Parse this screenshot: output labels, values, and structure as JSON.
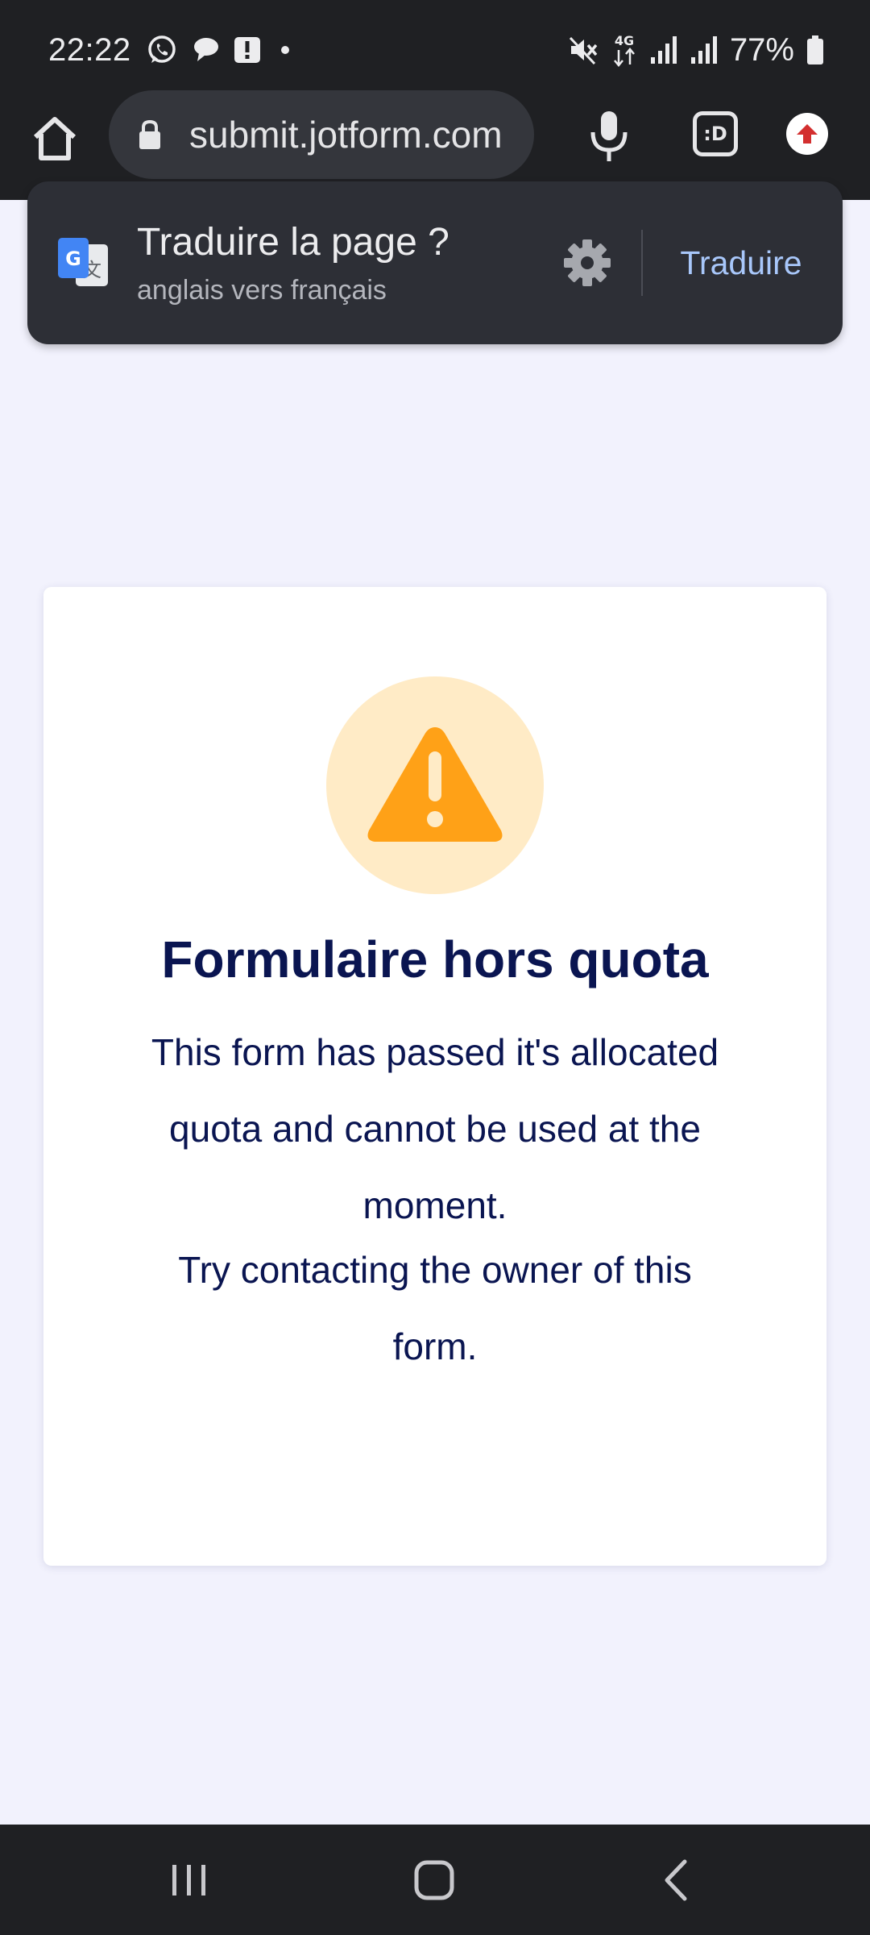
{
  "status_bar": {
    "time": "22:22",
    "battery": "77%",
    "left_icons": [
      "whatsapp-icon",
      "chat-bubble-icon",
      "alert-icon",
      "dot-icon"
    ],
    "right_icons": [
      "mute-icon",
      "network-4g-icon",
      "signal-icon",
      "signal-icon",
      "battery-icon"
    ],
    "network_label": "4G"
  },
  "browser": {
    "url": "submit.jotform.com",
    "tabs_label": ":D",
    "icons": [
      "home-icon",
      "lock-icon",
      "microphone-icon",
      "tabs-icon",
      "update-arrow-icon"
    ]
  },
  "translate": {
    "title": "Traduire la page ?",
    "subtitle": "anglais vers français",
    "button": "Traduire",
    "icons": [
      "google-translate-icon",
      "gear-icon"
    ]
  },
  "error_card": {
    "title": "Formulaire hors quota",
    "message": "This form has passed it's allocated quota and cannot be used at the moment.",
    "hint": "Try contacting the owner of this form.",
    "icon": "warning-icon",
    "colors": {
      "title": "#0a1551",
      "warning": "#ffa117",
      "warning_bg": "#ffebc6"
    }
  },
  "nav_bar": {
    "icons": [
      "recent-apps-icon",
      "home-nav-icon",
      "back-icon"
    ]
  },
  "colors": {
    "page_background": "#f2f2fd",
    "system_bars": "#1f2023",
    "translate_accent": "#a8c7fa"
  }
}
